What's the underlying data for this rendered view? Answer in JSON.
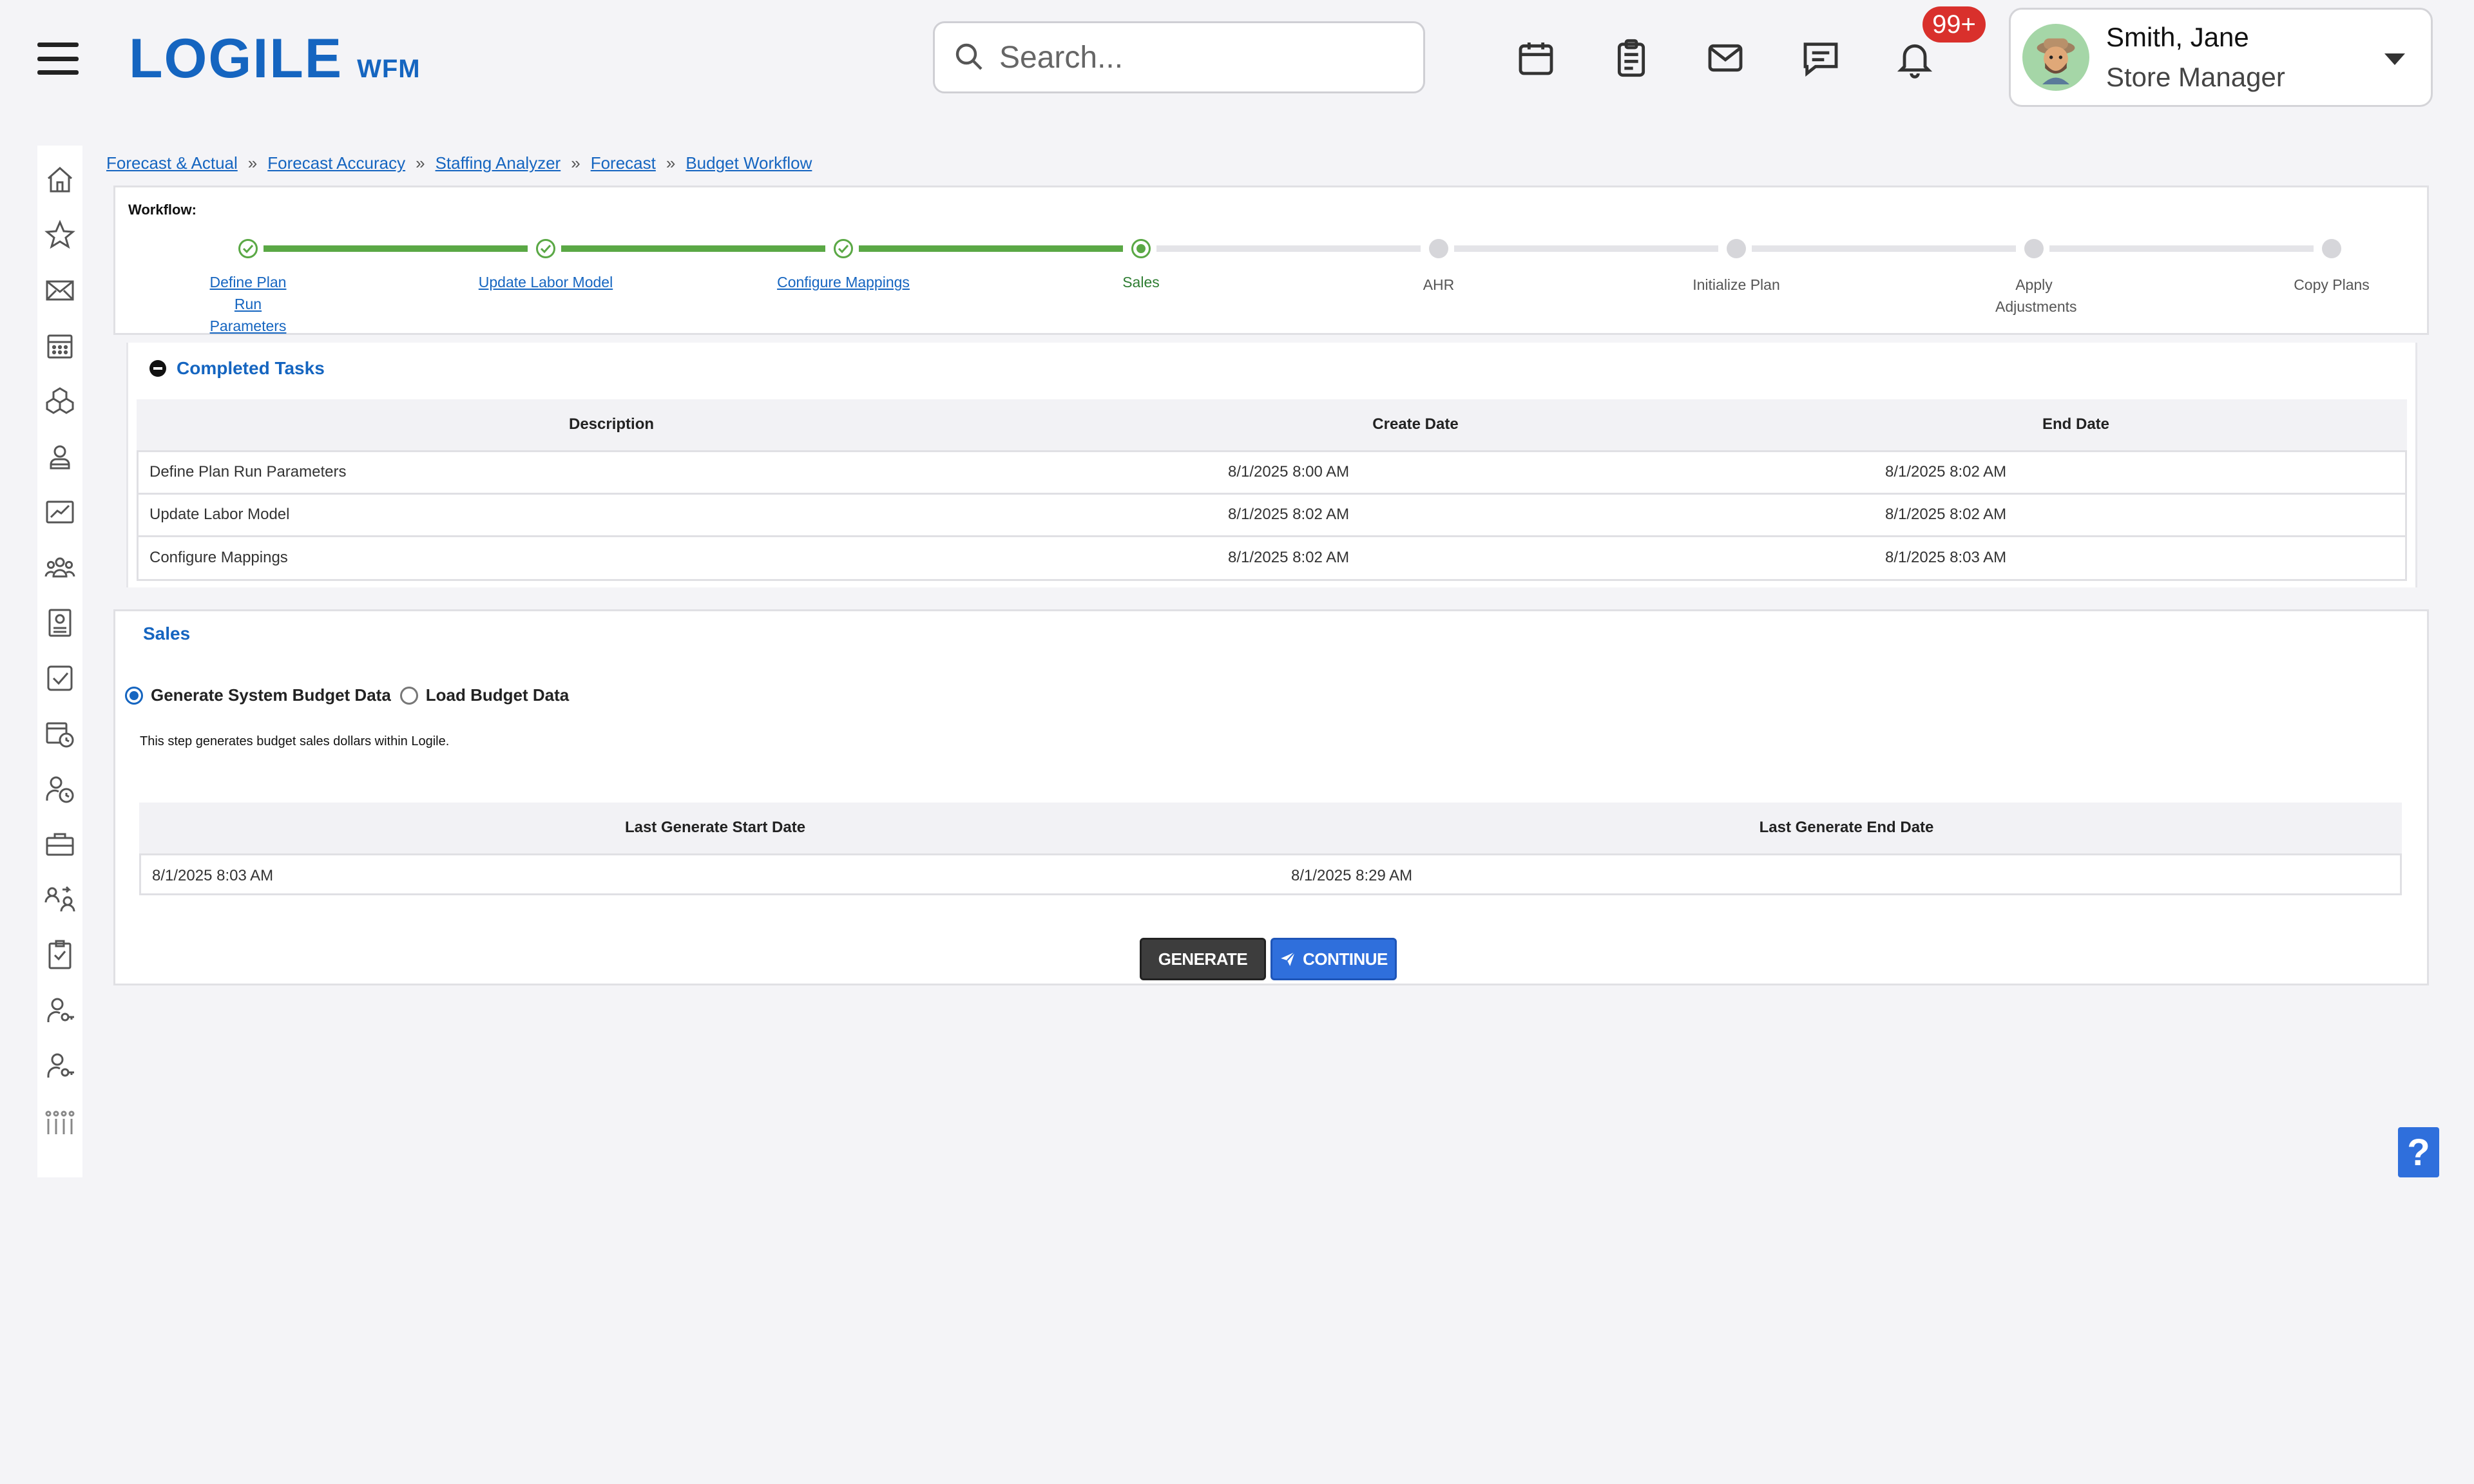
{
  "header": {
    "logo_text": "LOGILE",
    "logo_sub": "WFM",
    "search_placeholder": "Search...",
    "notification_count": "99+",
    "user_name": "Smith, Jane",
    "user_role": "Store Manager",
    "icons": [
      "menu-icon",
      "calendar-icon",
      "clipboard-icon",
      "mail-icon",
      "chat-icon",
      "bell-icon"
    ]
  },
  "sidebar": {
    "icons": [
      "home-icon",
      "star-icon",
      "envelope-icon",
      "calendar-grid-icon",
      "boxes-icon",
      "person-icon",
      "chart-icon",
      "team-icon",
      "register-icon",
      "checkbox-icon",
      "calendar-clock-icon",
      "person-clock-icon",
      "briefcase-icon",
      "swap-people-icon",
      "checklist-icon",
      "person-key-icon",
      "person-key-icon-2",
      "people-bars-icon"
    ]
  },
  "breadcrumb": [
    "Forecast & Actual",
    "Forecast Accuracy",
    "Staffing Analyzer",
    "Forecast",
    "Budget Workflow"
  ],
  "workflow": {
    "title": "Workflow:",
    "steps": [
      {
        "label": "Define Plan Run Parameters",
        "state": "done"
      },
      {
        "label": "Update Labor Model",
        "state": "done"
      },
      {
        "label": "Configure Mappings",
        "state": "done"
      },
      {
        "label": "Sales",
        "state": "active"
      },
      {
        "label": "AHR",
        "state": "pending"
      },
      {
        "label": "Initialize Plan",
        "state": "pending"
      },
      {
        "label": "Apply Adjustments",
        "state": "pending"
      },
      {
        "label": "Copy Plans",
        "state": "pending"
      }
    ]
  },
  "completed_tasks": {
    "title": "Completed Tasks",
    "columns": [
      "Description",
      "Create Date",
      "End Date"
    ],
    "rows": [
      [
        "Define Plan Run Parameters",
        "8/1/2025 8:00 AM",
        "8/1/2025 8:02 AM"
      ],
      [
        "Update Labor Model",
        "8/1/2025 8:02 AM",
        "8/1/2025 8:02 AM"
      ],
      [
        "Configure Mappings",
        "8/1/2025 8:02 AM",
        "8/1/2025 8:03 AM"
      ]
    ]
  },
  "sales": {
    "title": "Sales",
    "options": [
      {
        "label": "Generate System Budget Data",
        "selected": true
      },
      {
        "label": "Load Budget Data",
        "selected": false
      }
    ],
    "description": "This step generates budget sales dollars within Logile.",
    "columns": [
      "Last Generate Start Date",
      "Last Generate End Date"
    ],
    "rows": [
      [
        "8/1/2025 8:03 AM",
        "8/1/2025 8:29 AM"
      ]
    ],
    "generate_label": "GENERATE",
    "continue_label": "CONTINUE"
  },
  "help_label": "?",
  "colors": {
    "brand": "#1565c0",
    "done_green": "#5aa845",
    "pending_grey": "#d6d6da",
    "generate_btn": "#3d3d3d",
    "continue_btn": "#2f6fdc",
    "badge_red": "#d9302c"
  }
}
